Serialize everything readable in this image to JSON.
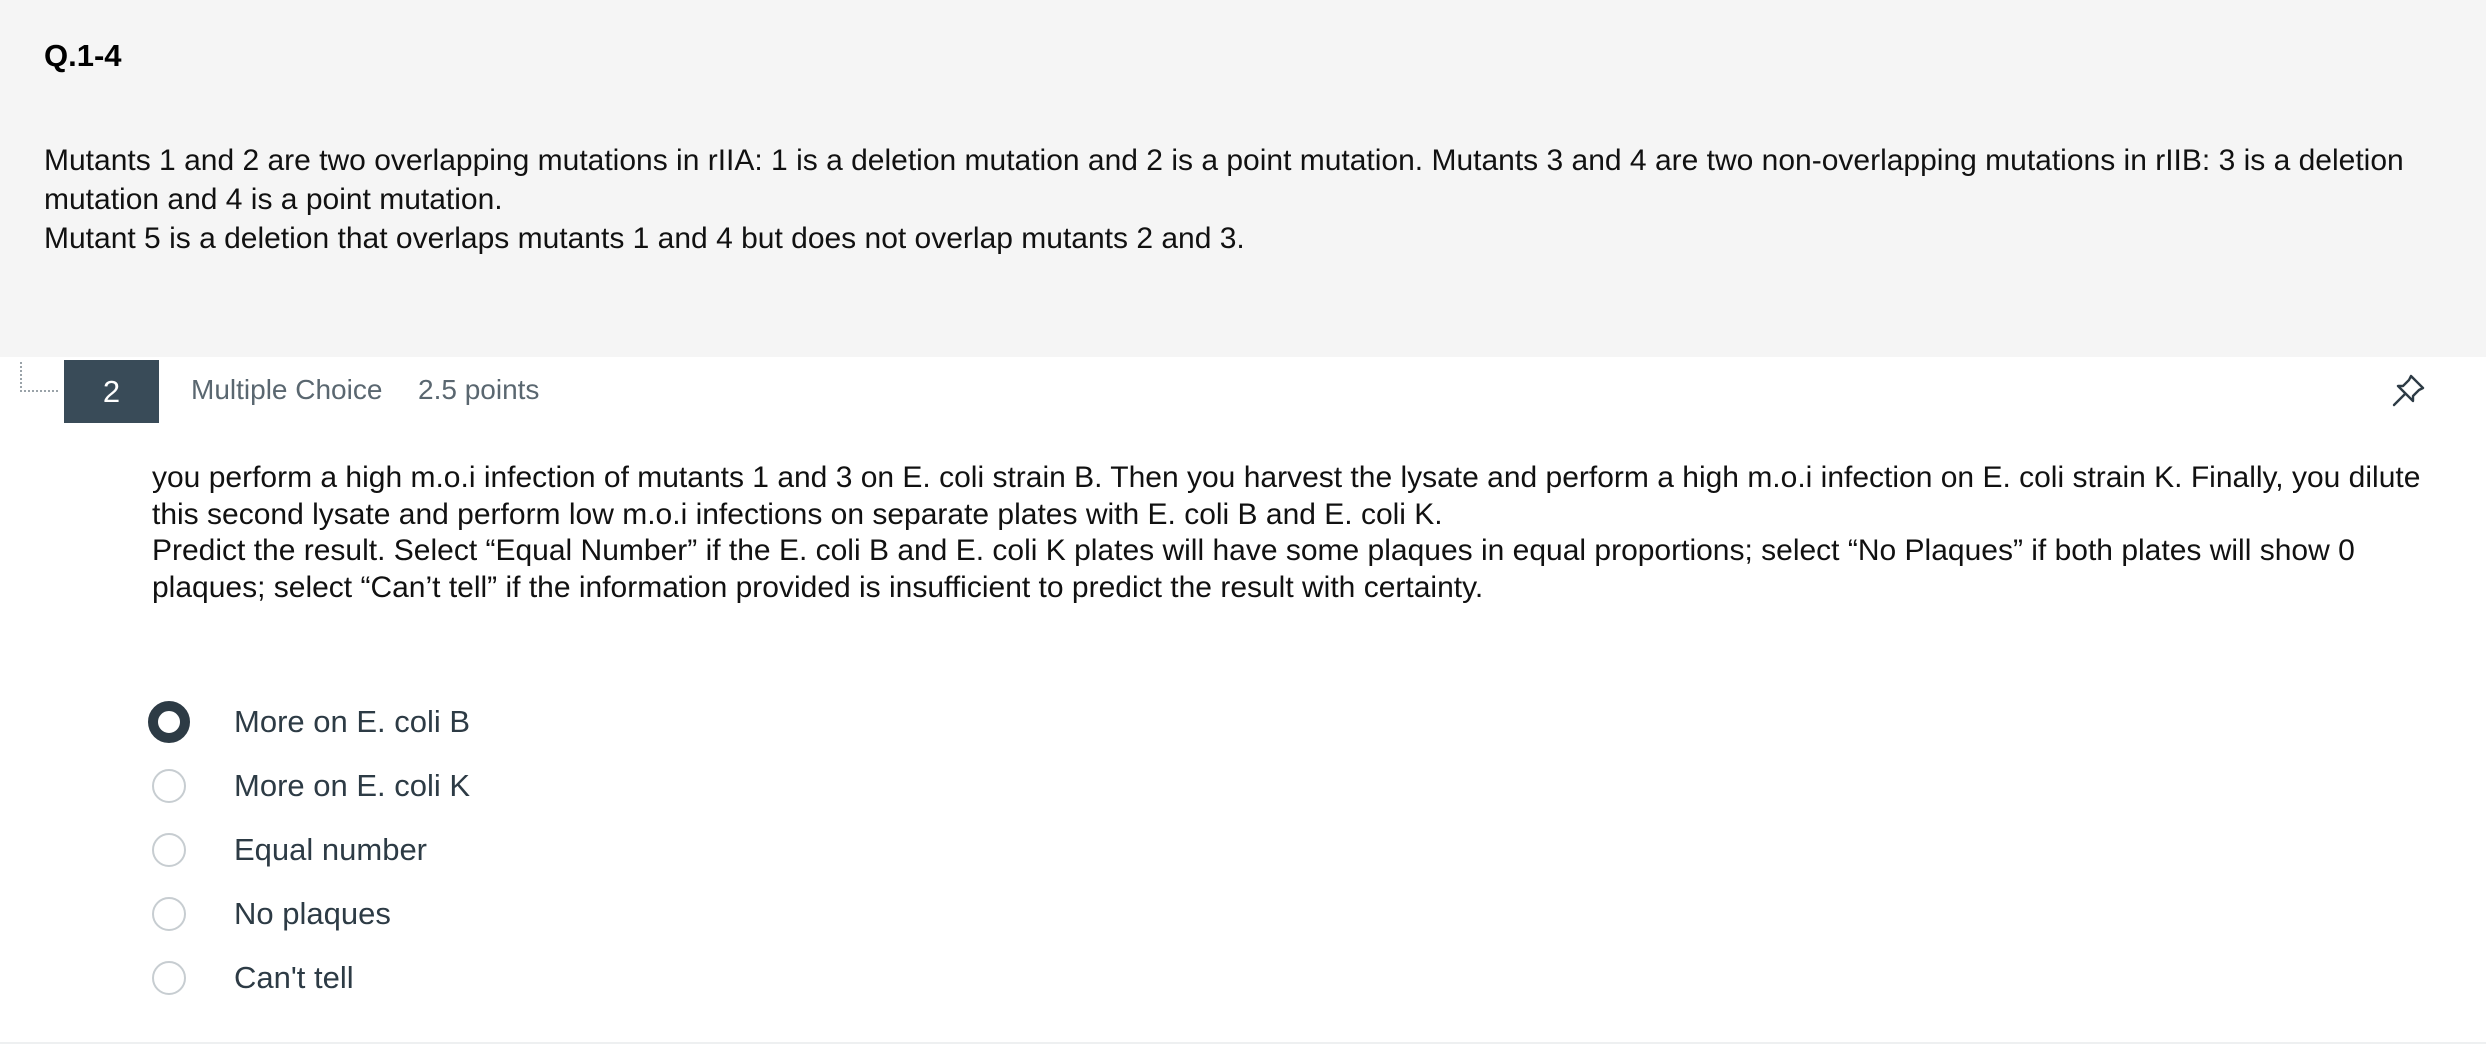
{
  "intro": {
    "title": "Q.1-4",
    "paragraph1": "Mutants 1 and 2 are two overlapping mutations in rIIA: 1 is a deletion mutation and 2 is a point mutation.  Mutants 3 and 4 are two non-overlapping mutations in rIIB:  3 is a deletion mutation and 4 is a point mutation.",
    "paragraph2": "Mutant 5 is a deletion that overlaps mutants 1 and 4 but does not overlap mutants 2 and 3."
  },
  "question": {
    "number": "2",
    "type": "Multiple Choice",
    "points": "2.5 points",
    "pin_icon": "pin-icon",
    "text1": "you perform a high m.o.i infection of mutants 1 and 3 on E. coli strain B. Then you harvest the lysate and perform a high m.o.i infection on E. coli strain K. Finally, you dilute this second lysate and perform low m.o.i infections on separate plates with E. coli B and E. coli K.",
    "text2": "Predict the result. Select “Equal Number” if the E. coli B and E. coli K plates will have some plaques in equal proportions; select “No Plaques” if both plates will show 0 plaques; select “Can’t tell” if the information provided is insufficient to predict the result with certainty.",
    "answers": [
      {
        "label": "More on E. coli B",
        "selected": true
      },
      {
        "label": "More on E. coli K",
        "selected": false
      },
      {
        "label": "Equal number",
        "selected": false
      },
      {
        "label": "No plaques",
        "selected": false
      },
      {
        "label": "Can't tell",
        "selected": false
      }
    ]
  },
  "colors": {
    "header_badge": "#394b58",
    "intro_bg": "#f5f5f5",
    "radio_selected": "#2d3b45"
  }
}
